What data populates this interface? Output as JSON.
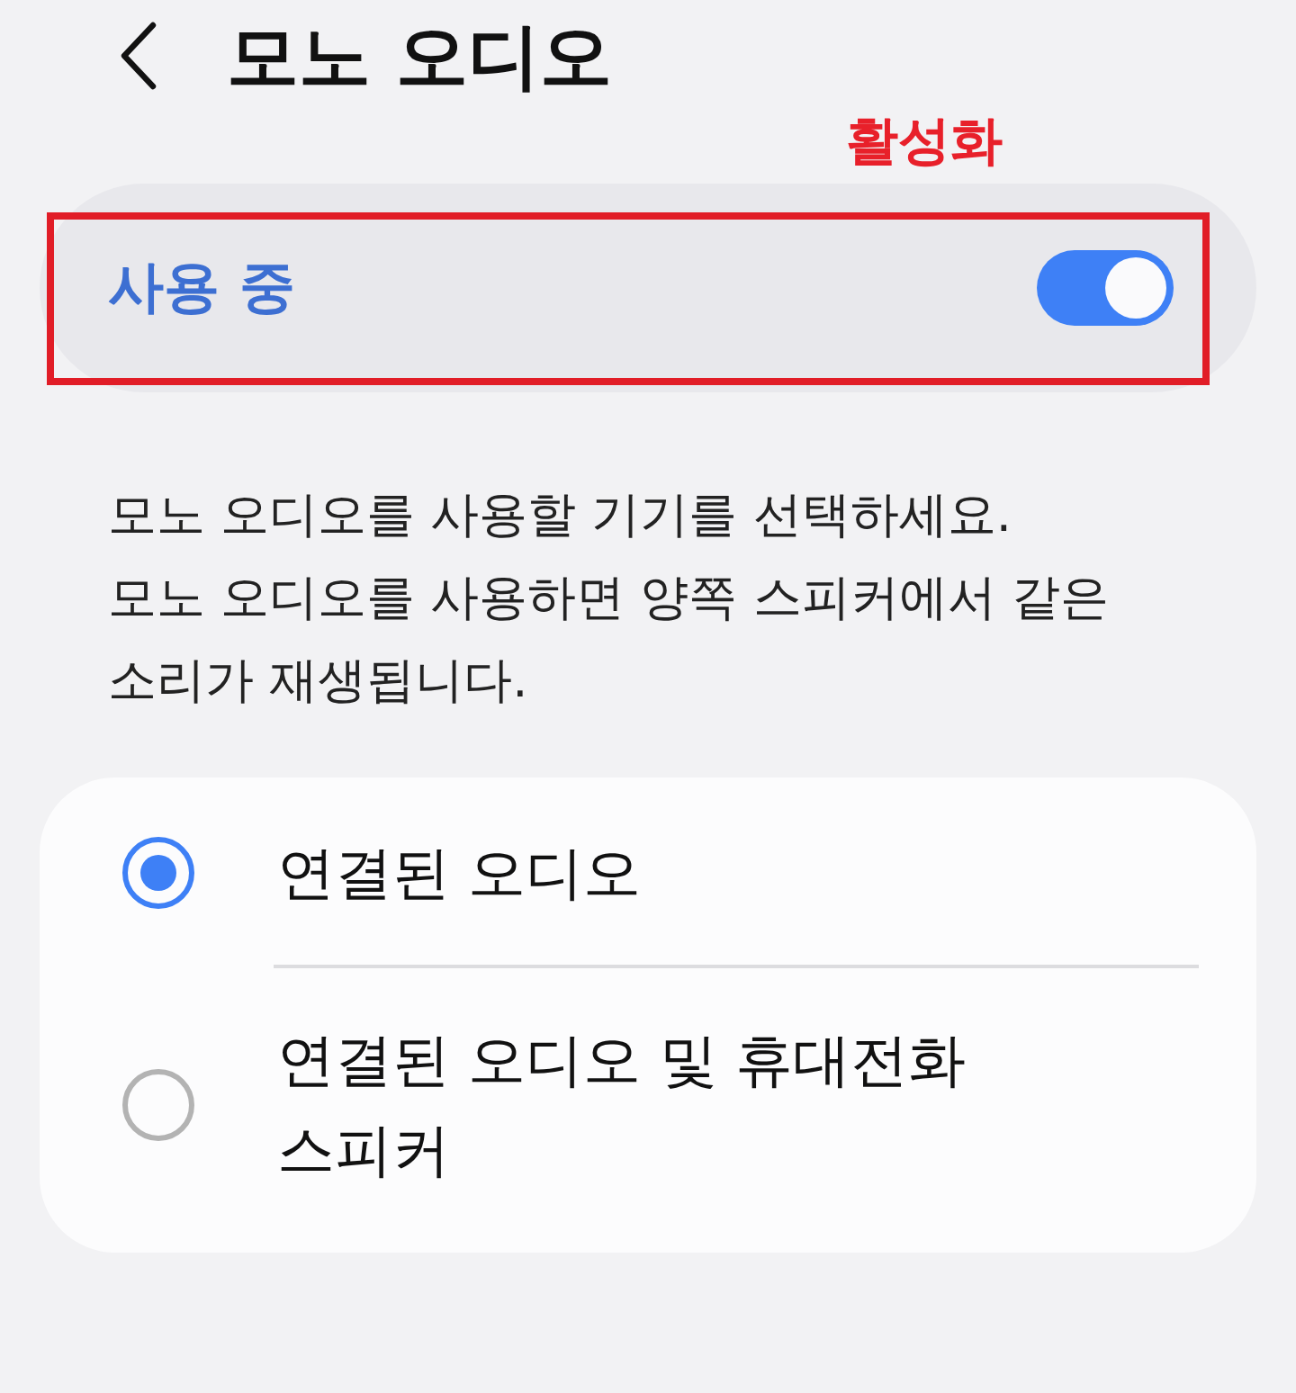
{
  "header": {
    "title": "모노 오디오"
  },
  "annotation": {
    "label": "활성화",
    "highlights_master_switch": true
  },
  "master_switch": {
    "label": "사용 중",
    "on": true
  },
  "description": [
    "모노 오디오를 사용할 기기를 선택하세요.",
    "모노 오디오를 사용하면 양쪽 스피커에서 같은 소리가 재생됩니다."
  ],
  "options": [
    {
      "label": "연결된 오디오",
      "selected": true
    },
    {
      "label": "연결된 오디오 및 휴대전화 스피커",
      "selected": false
    }
  ]
}
